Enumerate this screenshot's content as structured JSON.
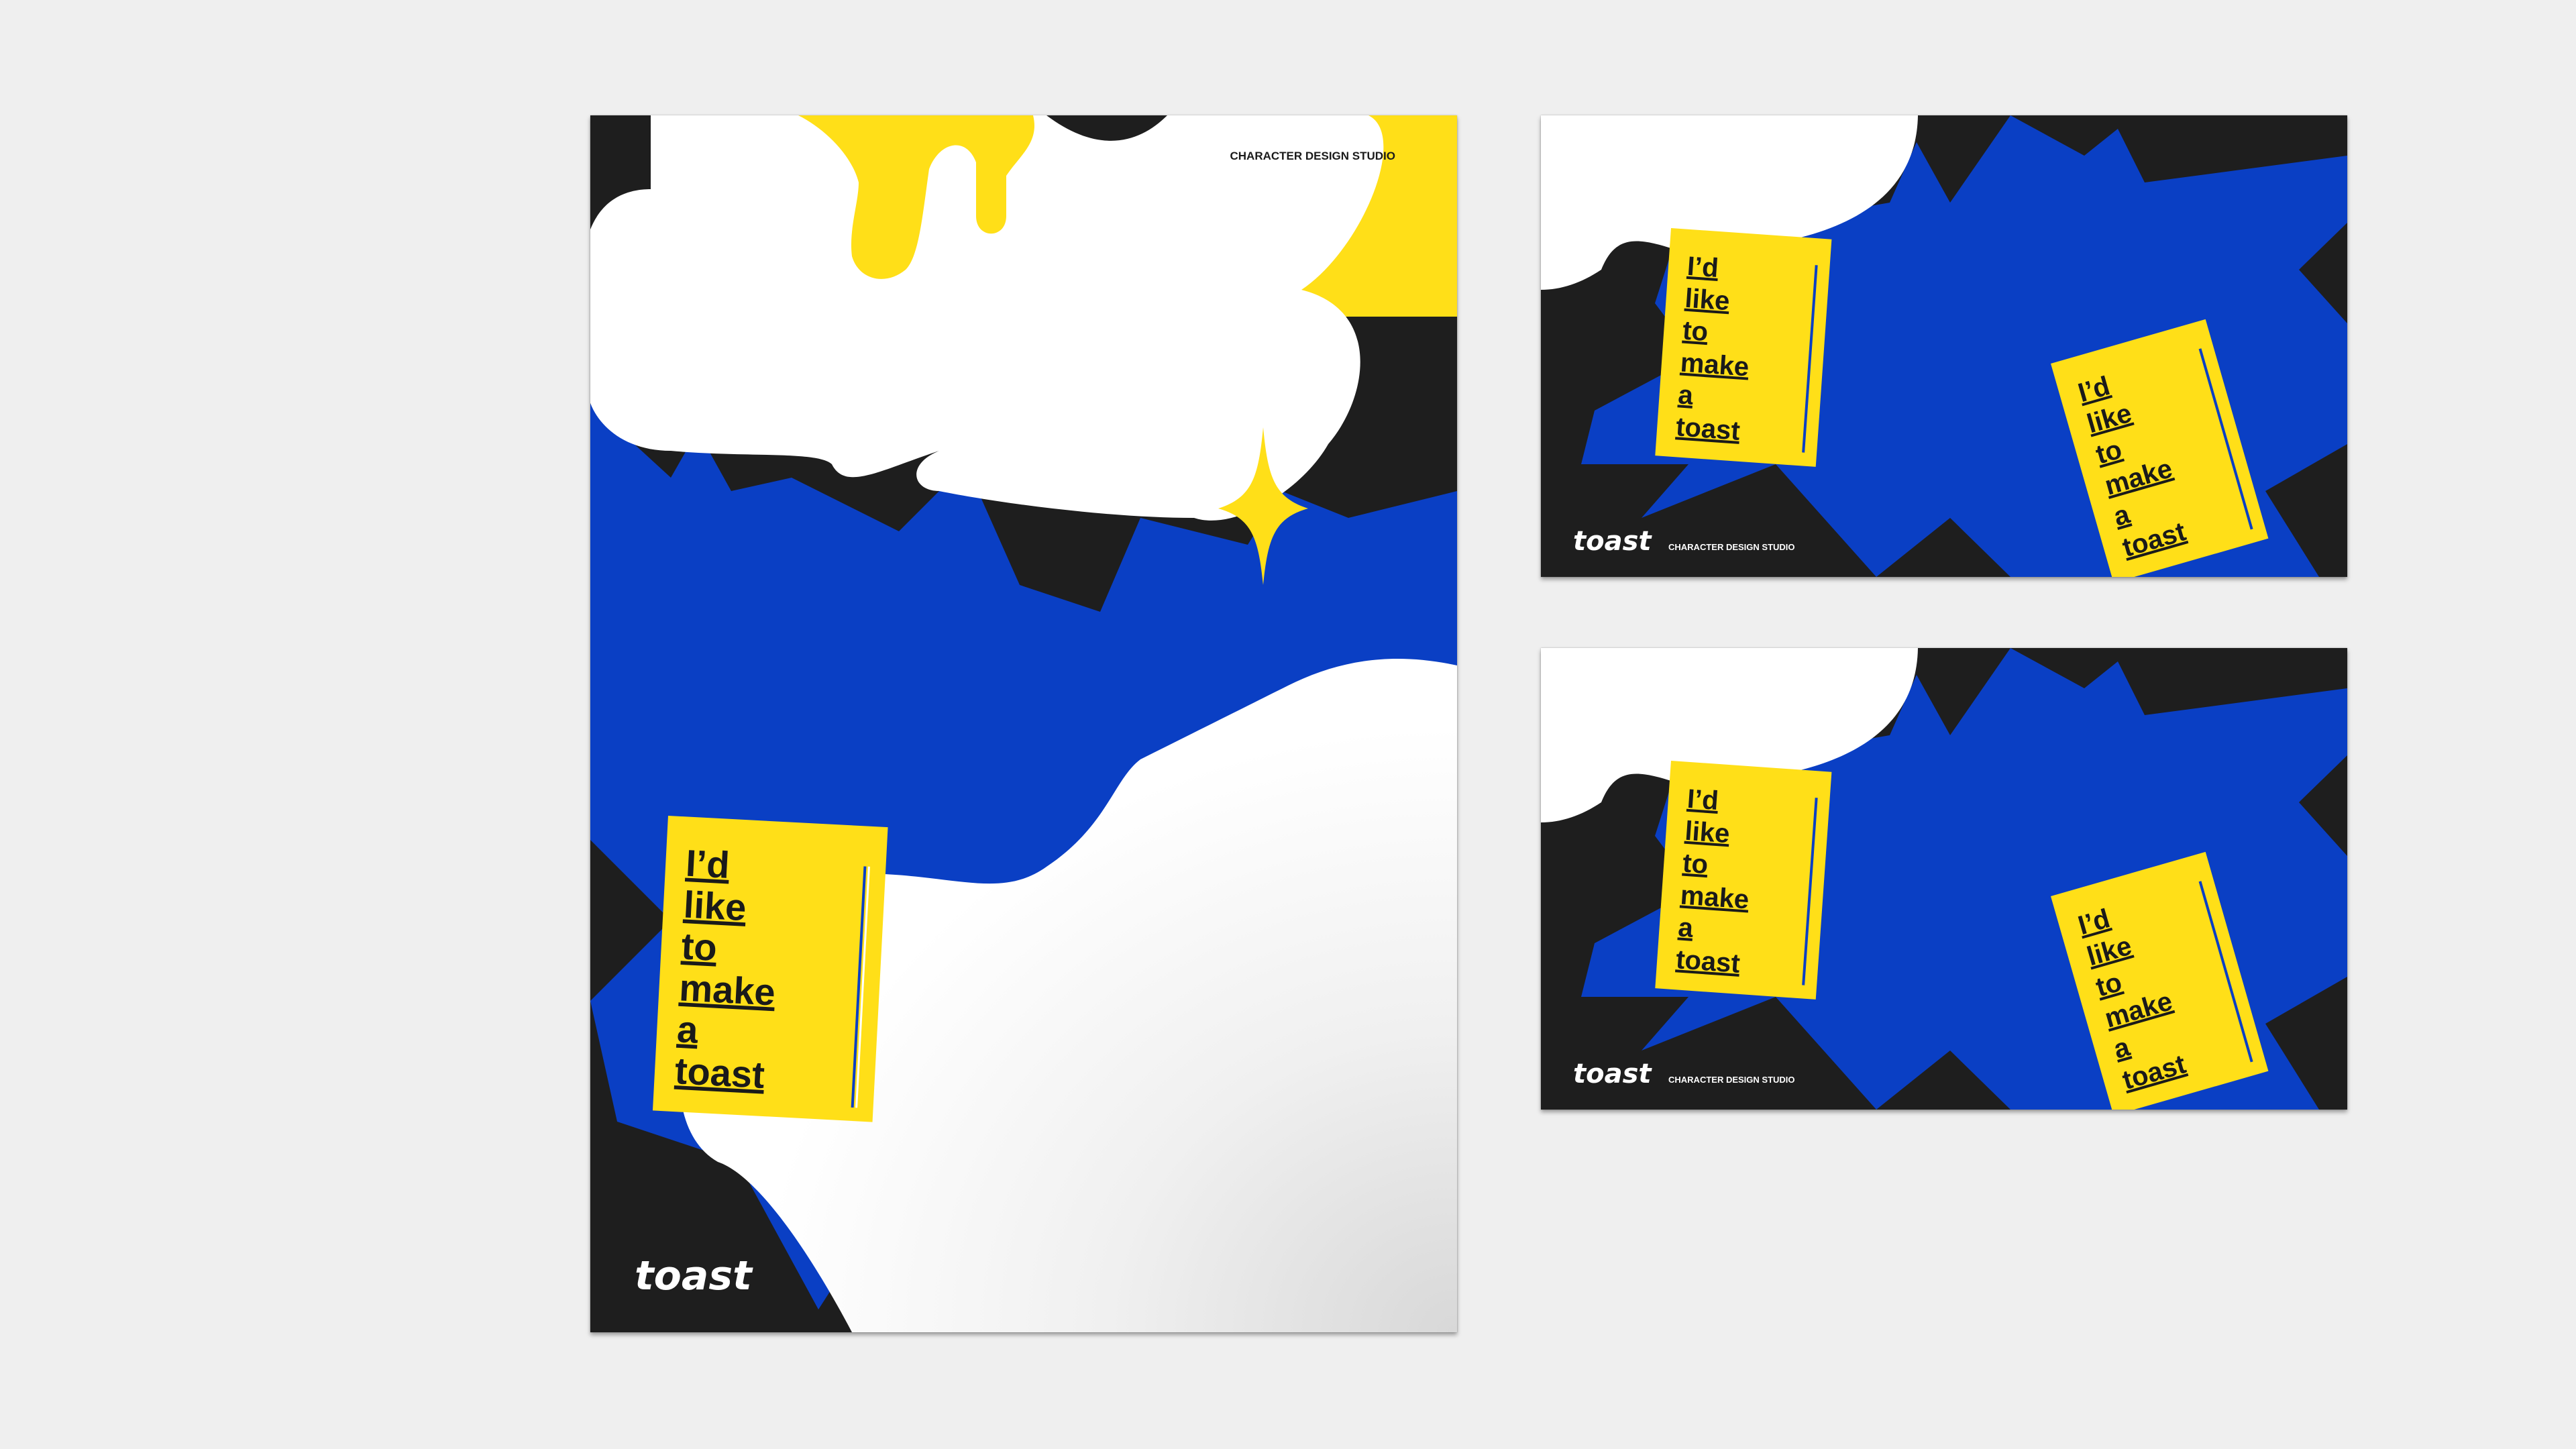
{
  "brand": {
    "logo_text": "toast",
    "studio_label": "CHARACTER DESIGN STUDIO"
  },
  "card": {
    "lines": [
      "I’d",
      "like",
      "to",
      "make",
      "a",
      "toast"
    ]
  },
  "colors": {
    "background": "#efefef",
    "black": "#1e1e1e",
    "blue": "#0a3fc4",
    "yellow": "#ffdf18",
    "white": "#ffffff"
  }
}
